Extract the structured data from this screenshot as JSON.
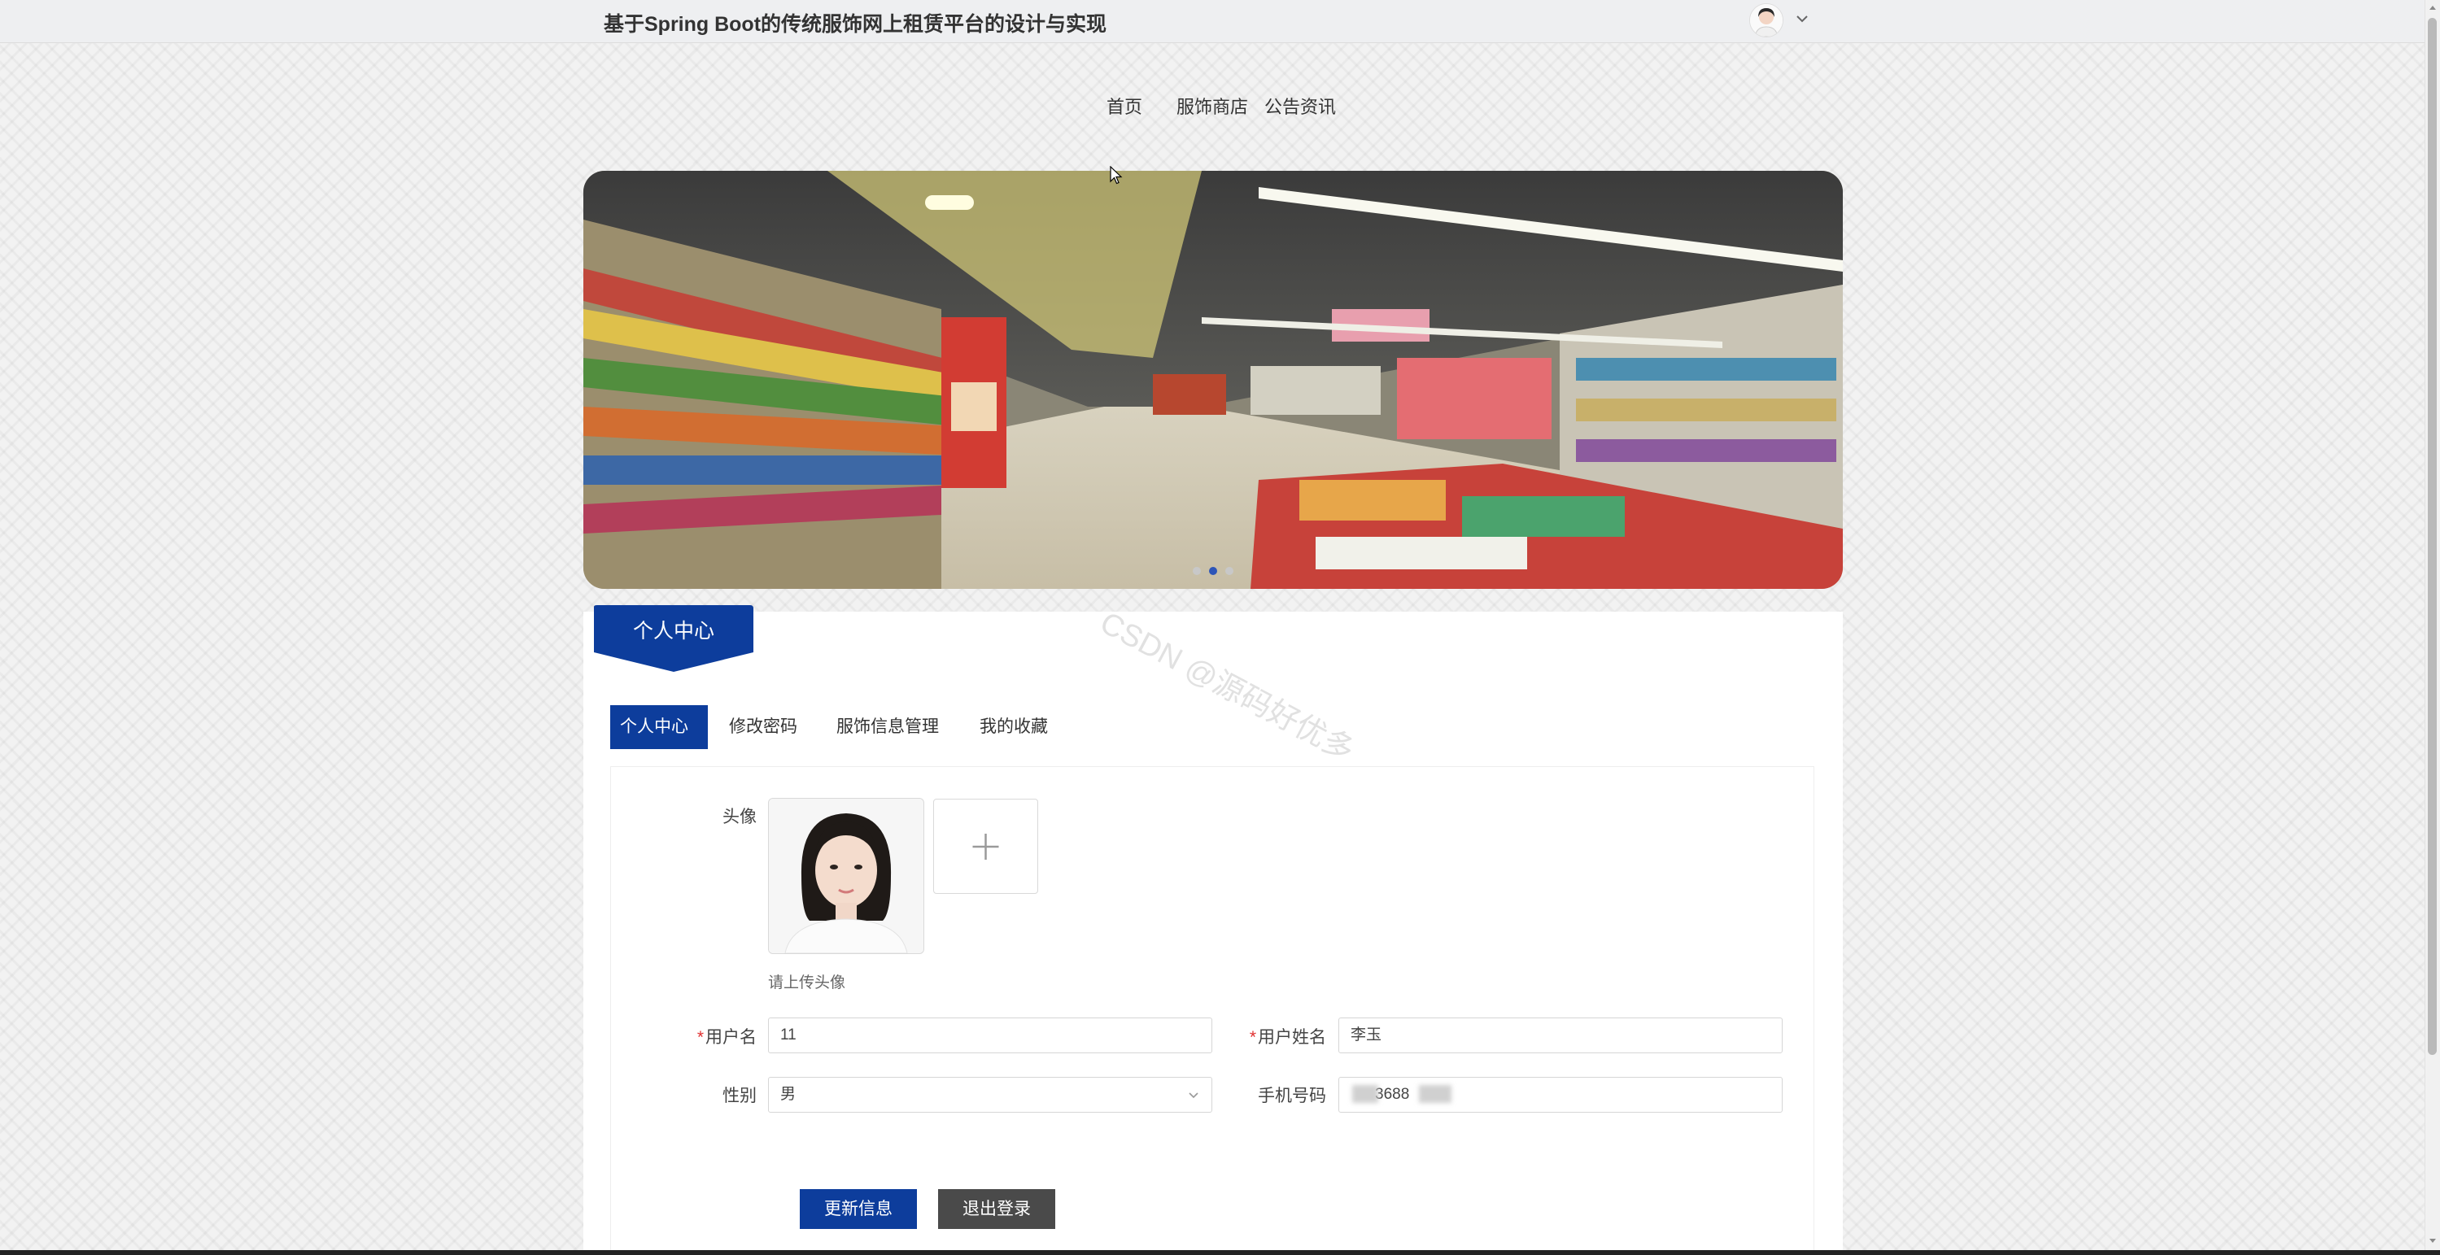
{
  "header": {
    "title": "基于Spring Boot的传统服饰网上租赁平台的设计与实现"
  },
  "nav": {
    "items": [
      {
        "label": "首页"
      },
      {
        "label": "服饰商店"
      },
      {
        "label": "公告资讯"
      }
    ]
  },
  "banner": {
    "slide_count": 3,
    "active_slide": 2
  },
  "watermark": "CSDN @源码好优多",
  "section": {
    "ribbon_title": "个人中心"
  },
  "tabs": [
    {
      "label": "个人中心",
      "active": true
    },
    {
      "label": "修改密码",
      "active": false
    },
    {
      "label": "服饰信息管理",
      "active": false
    },
    {
      "label": "我的收藏",
      "active": false
    }
  ],
  "form": {
    "avatar_label": "头像",
    "avatar_hint": "请上传头像",
    "username_label": "用户名",
    "username_value": "11",
    "realname_label": "用户姓名",
    "realname_value": "李玉",
    "gender_label": "性别",
    "gender_value": "男",
    "phone_label": "手机号码",
    "phone_value": "3688"
  },
  "buttons": {
    "update_label": "更新信息",
    "logout_label": "退出登录"
  },
  "colors": {
    "primary": "#0d3d9c",
    "dark_button": "#4a4a4a",
    "required": "#e03030"
  }
}
